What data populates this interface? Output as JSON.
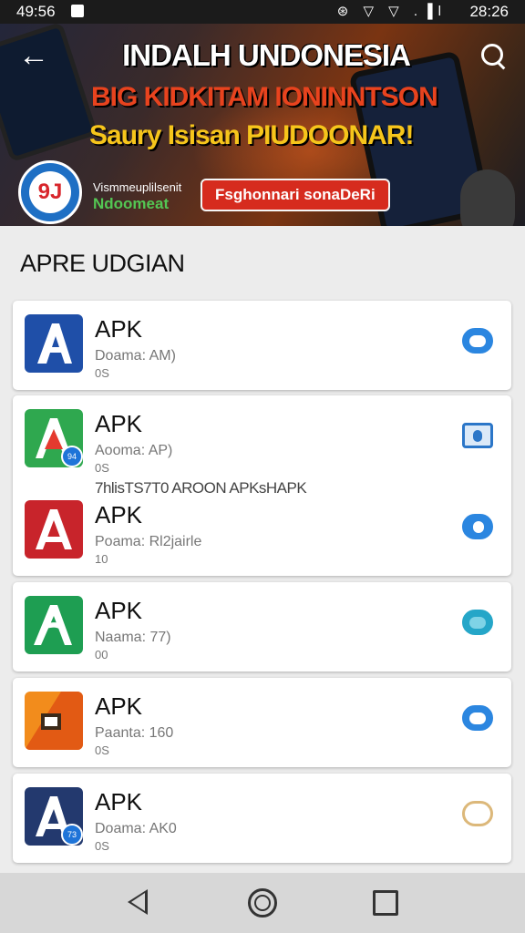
{
  "status_bar": {
    "left_time": "49:56",
    "icons": "⊛ ▽ ▽ .▐l",
    "right_time": "28:26"
  },
  "hero": {
    "title": "INDALH UNDONESIA",
    "line2": "BIG KIDKITAM IONINNTSON",
    "line3": "Saury Isisan PIUDOONAR!",
    "logo_text": "9J",
    "brand_line1": "Vismmeuplilsenit",
    "brand_line2": "Ndoomeat",
    "cta_label": "Fsghonnari sonaDeRi"
  },
  "section": {
    "title": "APRE UDGIAN"
  },
  "promo_text": "7hlisTS7T0 AROON APKsHAPK",
  "apps": [
    {
      "name": "APK",
      "sub1": "Doama: AM)",
      "sub2": "0S",
      "icon_bg": "#1f4fa8",
      "icon_fg": "#ffffff",
      "toggle_color": "#2b86e0"
    },
    {
      "name": "APK",
      "sub1": "Aooma: AP)",
      "sub2": "0S",
      "icon_bg": "#2fa84f",
      "icon_fg": "#e53a2f",
      "badge": "94",
      "toggle_color": "#2b76c8"
    },
    {
      "name": "APK",
      "sub1": "Poama: Rl2jairle",
      "sub2": "10",
      "icon_bg": "#c8242b",
      "icon_fg": "#ffffff",
      "toggle_color": "#2b86e0"
    },
    {
      "name": "APK",
      "sub1": "Naama: 77)",
      "sub2": "00",
      "icon_bg": "#1e9e52",
      "icon_fg": "#ffffff",
      "toggle_color": "#25a6c8"
    },
    {
      "name": "APK",
      "sub1": "Paanta: 160",
      "sub2": "0S",
      "icon_bg": "#f28c1c",
      "icon_fg": "#3b2a1a",
      "toggle_color": "#2b86e0"
    },
    {
      "name": "APK",
      "sub1": "Doama: AK0",
      "sub2": "0S",
      "icon_bg": "#23396e",
      "icon_fg": "#ffffff",
      "badge": "73",
      "toggle_color": "#dcb87a"
    }
  ]
}
